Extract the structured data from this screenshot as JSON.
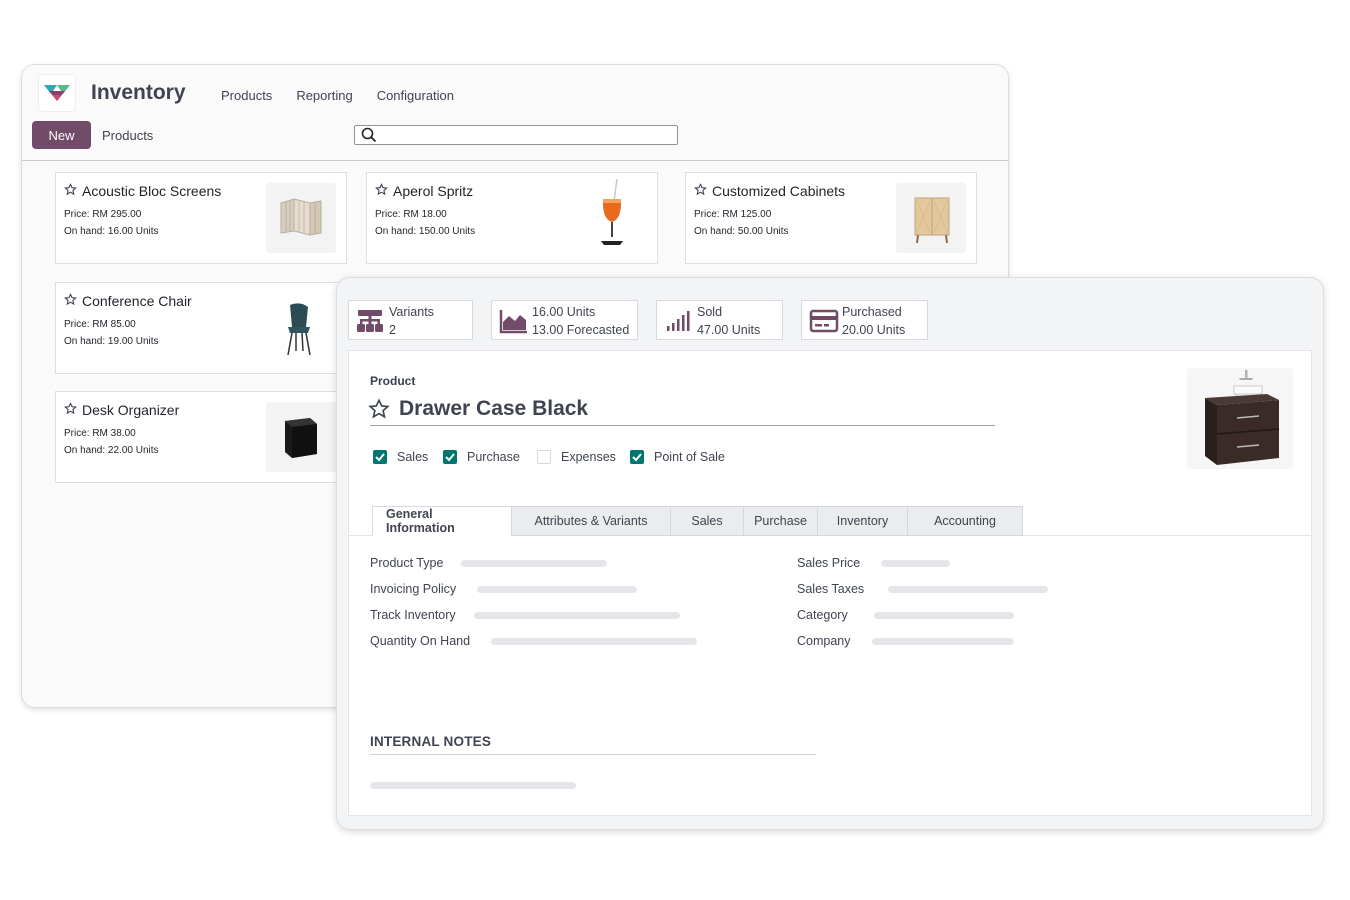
{
  "app": {
    "title": "Inventory",
    "menu": [
      "Products",
      "Reporting",
      "Configuration"
    ],
    "new_button": "New",
    "breadcrumb": "Products",
    "search_placeholder": ""
  },
  "cards": [
    {
      "name": "Acoustic Bloc Screens",
      "price": "Price: RM 295.00",
      "on_hand": "On hand: 16.00 Units",
      "icon": "screen-image"
    },
    {
      "name": "Aperol Spritz",
      "price": "Price: RM 18.00",
      "on_hand": "On hand: 150.00 Units",
      "icon": "drink-image"
    },
    {
      "name": "Customized Cabinets",
      "price": "Price: RM 125.00",
      "on_hand": "On hand: 50.00 Units",
      "icon": "cabinet-image"
    },
    {
      "name": "Conference Chair",
      "price": "Price: RM 85.00",
      "on_hand": "On hand: 19.00 Units",
      "icon": "chair-image"
    },
    {
      "name": "Desk Organizer",
      "price": "Price: RM 38.00",
      "on_hand": "On hand: 22.00 Units",
      "icon": "organizer-image"
    }
  ],
  "form": {
    "stats": [
      {
        "line1": "Variants",
        "line2": "2",
        "icon": "variants-icon"
      },
      {
        "line1": "16.00 Units",
        "line2": "13.00 Forecasted",
        "icon": "forecast-chart-icon"
      },
      {
        "line1": "Sold",
        "line2": "47.00 Units",
        "icon": "sold-bars-icon"
      },
      {
        "line1": "Purchased",
        "line2": "20.00 Units",
        "icon": "credit-card-icon"
      }
    ],
    "product_label": "Product",
    "product_name": "Drawer Case Black",
    "checkboxes": [
      {
        "label": "Sales",
        "checked": true
      },
      {
        "label": "Purchase",
        "checked": true
      },
      {
        "label": "Expenses",
        "checked": false
      },
      {
        "label": "Point of Sale",
        "checked": true
      }
    ],
    "tabs": [
      "General Information",
      "Attributes & Variants",
      "Sales",
      "Purchase",
      "Inventory",
      "Accounting"
    ],
    "active_tab": "General Information",
    "left_fields": [
      "Product Type",
      "Invoicing Policy",
      "Track Inventory",
      "Quantity On Hand"
    ],
    "right_fields": [
      "Sales Price",
      "Sales Taxes",
      "Category",
      "Company"
    ],
    "notes_title": "INTERNAL NOTES"
  },
  "colors": {
    "brand": "#714b67",
    "check": "#00766e"
  }
}
